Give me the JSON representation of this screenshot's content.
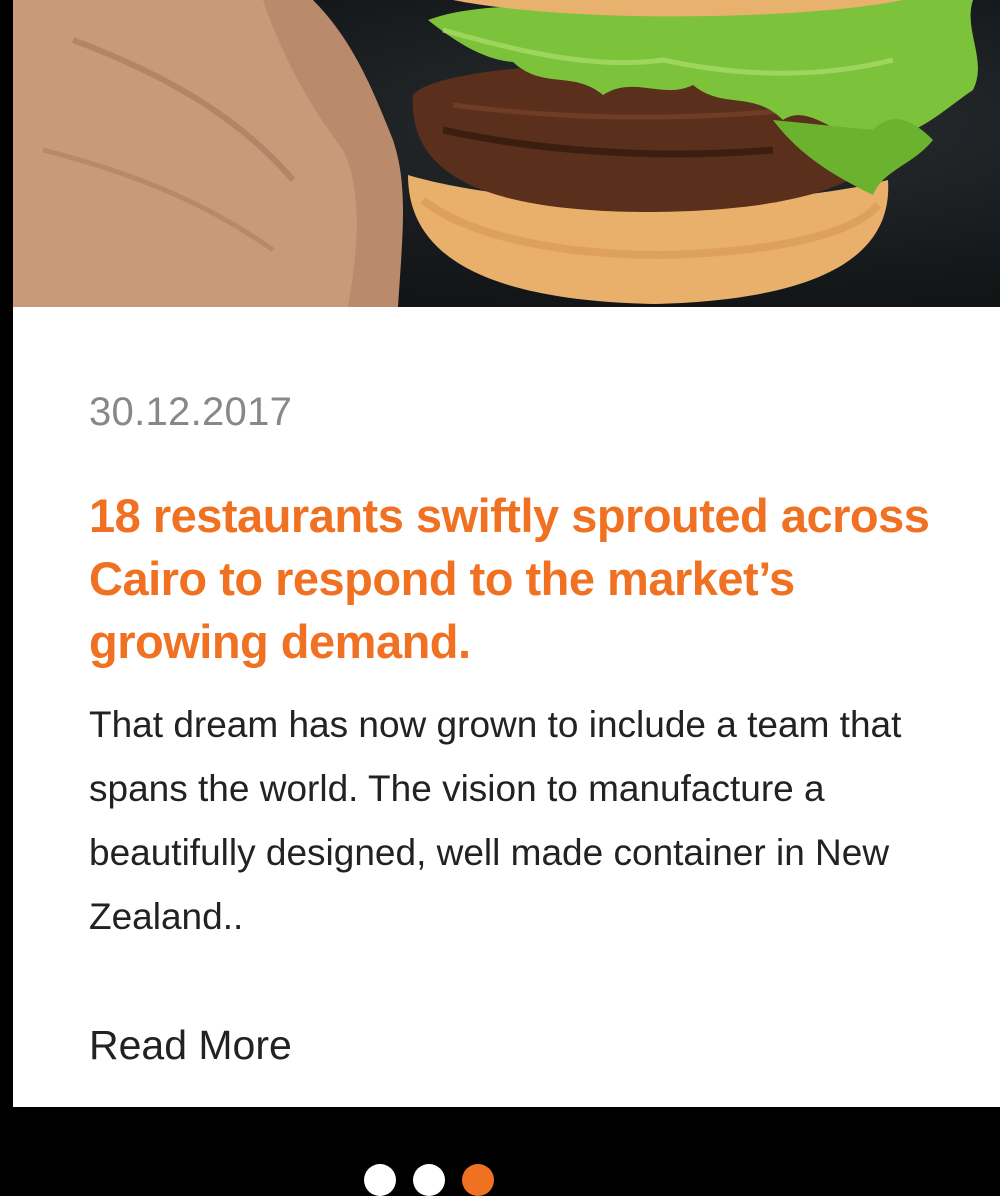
{
  "article": {
    "image_alt": "burger-held-in-hand",
    "date": "30.12.2017",
    "title": "18 restaurants swiftly sprouted across Cairo to respond to the market’s growing demand.",
    "excerpt": "That dream has now grown to include a team that spans the world. The vision to manufacture a beautifully designed, well made container in New Zealand..",
    "read_more_label": "Read More"
  },
  "carousel": {
    "total": 3,
    "active_index": 2
  },
  "colors": {
    "accent": "#f07122",
    "background": "#000000",
    "card": "#ffffff",
    "date_text": "#888888",
    "body_text": "#222222"
  }
}
